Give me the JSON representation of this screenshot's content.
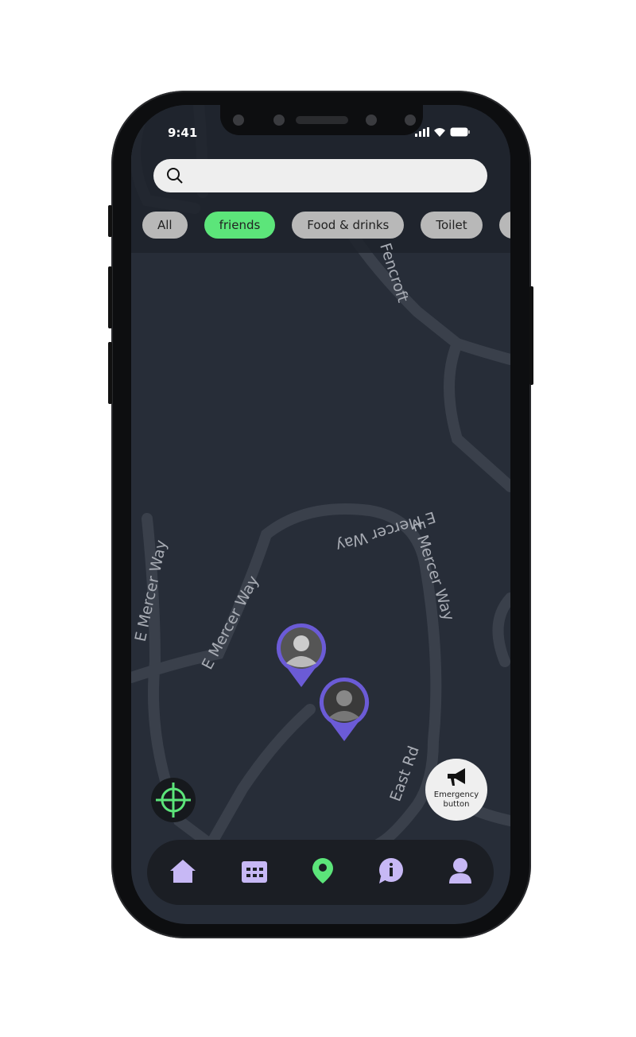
{
  "status_bar": {
    "time": "9:41"
  },
  "search": {
    "placeholder": "",
    "value": ""
  },
  "filters": [
    {
      "label": "All",
      "active": false
    },
    {
      "label": "friends",
      "active": true
    },
    {
      "label": "Food & drinks",
      "active": false
    },
    {
      "label": "Toilet",
      "active": false
    }
  ],
  "map": {
    "road_labels": [
      "Fencroft",
      "E Mercer Way",
      "E Mercer Way",
      "E Mercer Way",
      "E Mercer Way",
      "East Rd"
    ]
  },
  "markers": [
    {
      "name": "friend-1"
    },
    {
      "name": "friend-2"
    }
  ],
  "emergency": {
    "line1": "Emergency",
    "line2": "button"
  },
  "nav": {
    "items": [
      "home-icon",
      "calendar-icon",
      "location-icon",
      "info-icon",
      "profile-icon"
    ],
    "active": "location-icon"
  },
  "colors": {
    "accent": "#5ce57a",
    "marker": "#6b5bd6",
    "nav_icon": "#c7b8f5",
    "map_bg": "#272d38"
  }
}
